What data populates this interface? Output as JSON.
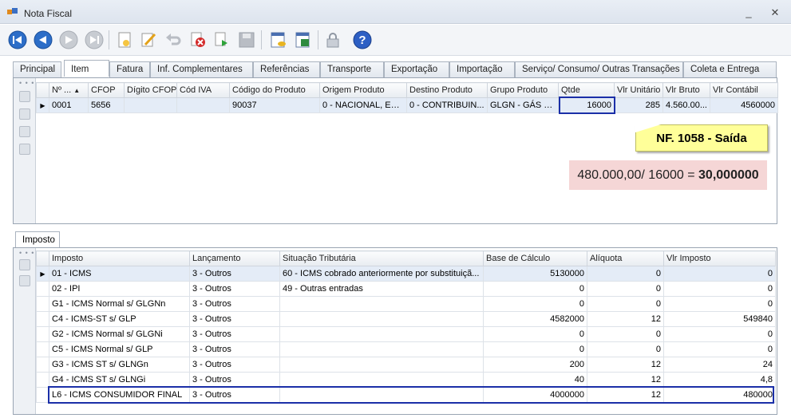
{
  "window": {
    "title": "Nota Fiscal",
    "minimize_glyph": "_",
    "close_glyph": "✕"
  },
  "toolbar": {
    "buttons": [
      {
        "name": "first-record-icon"
      },
      {
        "name": "prev-record-icon"
      },
      {
        "name": "next-record-icon"
      },
      {
        "name": "last-record-icon"
      },
      {
        "name": "new-record-icon"
      },
      {
        "name": "edit-record-icon"
      },
      {
        "name": "undo-icon"
      },
      {
        "name": "delete-icon"
      },
      {
        "name": "confirm-icon"
      },
      {
        "name": "save-icon"
      },
      {
        "name": "report-icon"
      },
      {
        "name": "export-excel-icon"
      },
      {
        "name": "lock-icon"
      },
      {
        "name": "help-icon"
      }
    ]
  },
  "tabs": [
    "Principal",
    "Item",
    "Fatura",
    "Inf. Complementares",
    "Referências",
    "Transporte",
    "Exportação",
    "Importação",
    "Serviço/ Consumo/ Outras Transações",
    "Coleta e Entrega"
  ],
  "active_tab": "Item",
  "items_grid": {
    "columns": [
      "Nº ...",
      "CFOP",
      "Dígito CFOP",
      "Cód IVA",
      "Código do Produto",
      "Origem Produto",
      "Destino Produto",
      "Grupo Produto",
      "Qtde",
      "Vlr Unitário",
      "Vlr Bruto",
      "Vlr Contábil"
    ],
    "sort_indicator": "▲",
    "row": [
      "0001",
      "5656",
      "",
      "",
      "90037",
      "0 - NACIONAL, EX...",
      "0 - CONTRIBUIN...",
      "GLGN - GÁS LI...",
      "16000",
      "285",
      "4.560.00...",
      "4560000"
    ]
  },
  "annotation": {
    "label": "NF. 1058 - Saída",
    "calc_prefix": "480.000,00/ 16000 = ",
    "calc_result": "30,000000"
  },
  "sub_tab": "Imposto",
  "tax_grid": {
    "columns": [
      "Imposto",
      "Lançamento",
      "Situação Tributária",
      "Base de Cálculo",
      "Alíquota",
      "Vlr Imposto"
    ],
    "rows": [
      [
        "01 - ICMS",
        "3 - Outros",
        "60 - ICMS cobrado anteriormente por substituiçã...",
        "5130000",
        "0",
        "0"
      ],
      [
        "02 - IPI",
        "3 - Outros",
        "49 - Outras entradas",
        "0",
        "0",
        "0"
      ],
      [
        "G1 - ICMS Normal s/ GLGNn",
        "3 - Outros",
        "",
        "0",
        "0",
        "0"
      ],
      [
        "C4 - ICMS-ST s/ GLP",
        "3 - Outros",
        "",
        "4582000",
        "12",
        "549840"
      ],
      [
        "G2 - ICMS Normal s/ GLGNi",
        "3 - Outros",
        "",
        "0",
        "0",
        "0"
      ],
      [
        "C5 - ICMS Normal s/ GLP",
        "3 - Outros",
        "",
        "0",
        "0",
        "0"
      ],
      [
        "G3 - ICMS ST s/ GLNGn",
        "3 - Outros",
        "",
        "200",
        "12",
        "24"
      ],
      [
        "G4 - ICMS ST s/ GLNGi",
        "3 - Outros",
        "",
        "40",
        "12",
        "4,8"
      ],
      [
        "L6 - ICMS CONSUMIDOR FINAL",
        "3 - Outros",
        "",
        "4000000",
        "12",
        "480000"
      ]
    ]
  },
  "colors": {
    "highlight_border": "#1b2fa8",
    "note_yellow": "#ffff99",
    "calc_pink": "#f5d6d6"
  }
}
